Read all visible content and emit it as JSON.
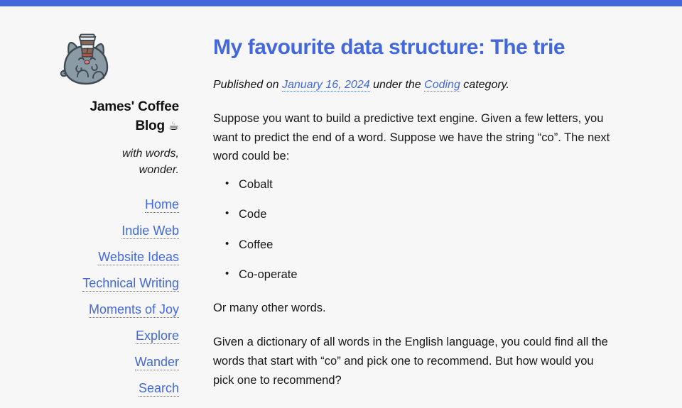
{
  "theme": {
    "accent": "#4268dc",
    "background": "#f7f7f7",
    "text": "#17171a"
  },
  "topbar": {
    "name": "site-accent-bar"
  },
  "sidebar": {
    "logo": {
      "alt": "cat-with-coffee-cup-logo",
      "cup_letter": "J"
    },
    "site_title": "James' Coffee Blog",
    "site_title_emoji": "☕",
    "tagline": "with words, wonder.",
    "nav_items": [
      {
        "label": "Home"
      },
      {
        "label": "Indie Web"
      },
      {
        "label": "Website Ideas"
      },
      {
        "label": "Technical Writing"
      },
      {
        "label": "Moments of Joy"
      },
      {
        "label": "Explore"
      },
      {
        "label": "Wander"
      },
      {
        "label": "Search"
      }
    ]
  },
  "article": {
    "title": "My favourite data structure: The trie",
    "meta": {
      "published_prefix": "Published on",
      "date": "January 16, 2024",
      "middle": "under the",
      "category": "Coding",
      "suffix": "category."
    },
    "paragraph_1": "Suppose you want to build a predictive text engine. Given a few letters, you want to predict the end of a word. Suppose we have the string “co”. The next word could be:",
    "word_list": [
      "Cobalt",
      "Code",
      "Coffee",
      "Co-operate"
    ],
    "paragraph_2": "Or many other words.",
    "paragraph_3": "Given a dictionary of all words in the English language, you could find all the words that start with “co” and pick one to recommend. But how would you pick one to recommend?"
  }
}
